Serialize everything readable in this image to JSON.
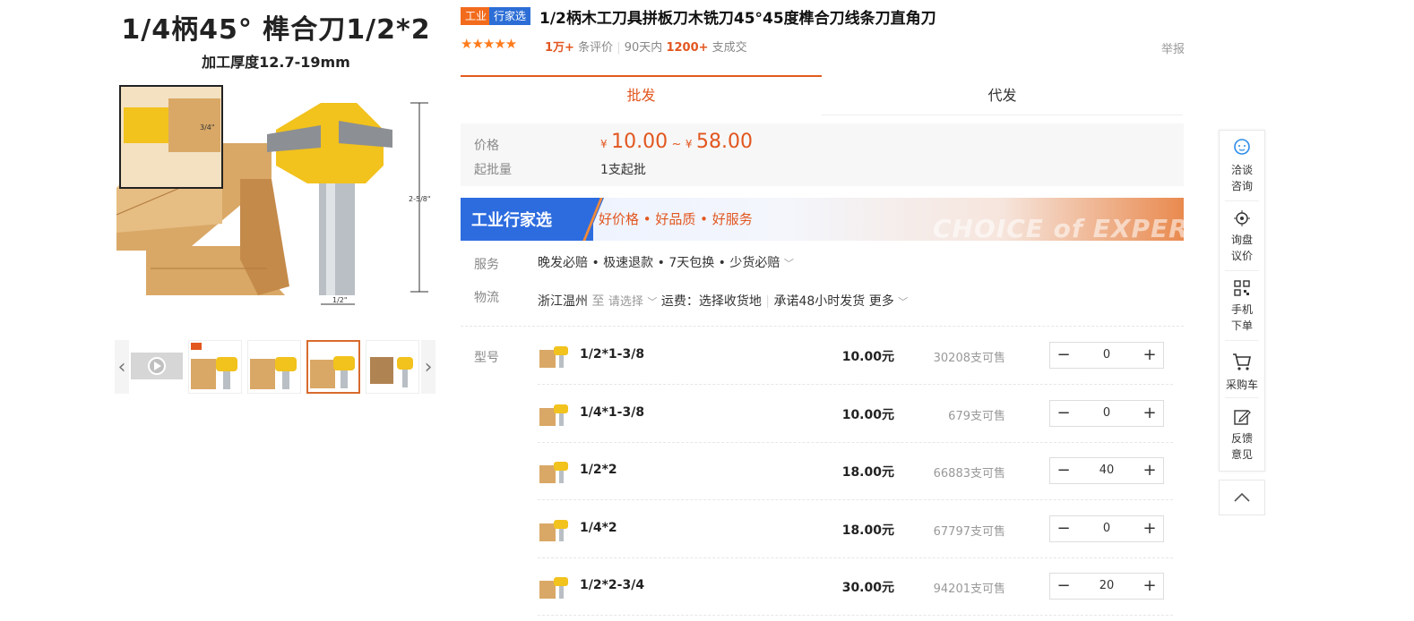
{
  "gallery": {
    "main_title": "1/4柄45°  榫合刀1/2*2",
    "main_subtitle": "加工厚度12.7-19mm",
    "dim_top": "3/4\"",
    "dim_side": "2-5/8\"",
    "dim_bottom": "1/2\""
  },
  "header": {
    "badge_a": "工业",
    "badge_b": "行家选",
    "title": "1/2柄木工刀具拼板刀木铣刀45°45度榫合刀线条刀直角刀",
    "rating_stars": "★★★★★",
    "reviews_count": "1万+",
    "reviews_label": "条评价",
    "period_label": "90天内",
    "deals_count": "1200+",
    "deals_label": "支成交",
    "report": "举报"
  },
  "tabs": [
    {
      "label": "批发"
    },
    {
      "label": "代发"
    }
  ],
  "price": {
    "price_label": "价格",
    "currency": "¥",
    "min": "10.00",
    "tilde": "~",
    "max": "58.00",
    "moq_label": "起批量",
    "moq_value": "1支起批"
  },
  "banner": {
    "left": "工业行家选",
    "mid": "好价格 • 好品质 • 好服务",
    "watermark": "CHOICE of EXPERT"
  },
  "service": {
    "label": "服务",
    "value": "晚发必赔 • 极速退款 • 7天包换 • 少货必赔"
  },
  "logistics": {
    "label": "物流",
    "from": "浙江温州",
    "to_word": "至",
    "select": "请选择",
    "fee": "运费：选择收货地",
    "promise": "承诺48小时发货",
    "more": "更多"
  },
  "sku": {
    "label": "型号",
    "rows": [
      {
        "name": "1/2*1-3/8",
        "price": "10.00元",
        "stock": "30208支可售",
        "qty": "0"
      },
      {
        "name": "1/4*1-3/8",
        "price": "10.00元",
        "stock": "679支可售",
        "qty": "0"
      },
      {
        "name": "1/2*2",
        "price": "18.00元",
        "stock": "66883支可售",
        "qty": "40"
      },
      {
        "name": "1/4*2",
        "price": "18.00元",
        "stock": "67797支可售",
        "qty": "0"
      },
      {
        "name": "1/2*2-3/4",
        "price": "30.00元",
        "stock": "94201支可售",
        "qty": "20"
      }
    ]
  },
  "float": {
    "chat": [
      "洽谈",
      "咨询"
    ],
    "inquiry": [
      "询盘",
      "议价"
    ],
    "mobile": [
      "手机",
      "下单"
    ],
    "cart": "采购车",
    "feedback": [
      "反馈",
      "意见"
    ]
  },
  "colors": {
    "accent": "#e2561f",
    "blue": "#2c6ed6",
    "wood": "#d9a866",
    "cutter": "#f2c21d"
  }
}
